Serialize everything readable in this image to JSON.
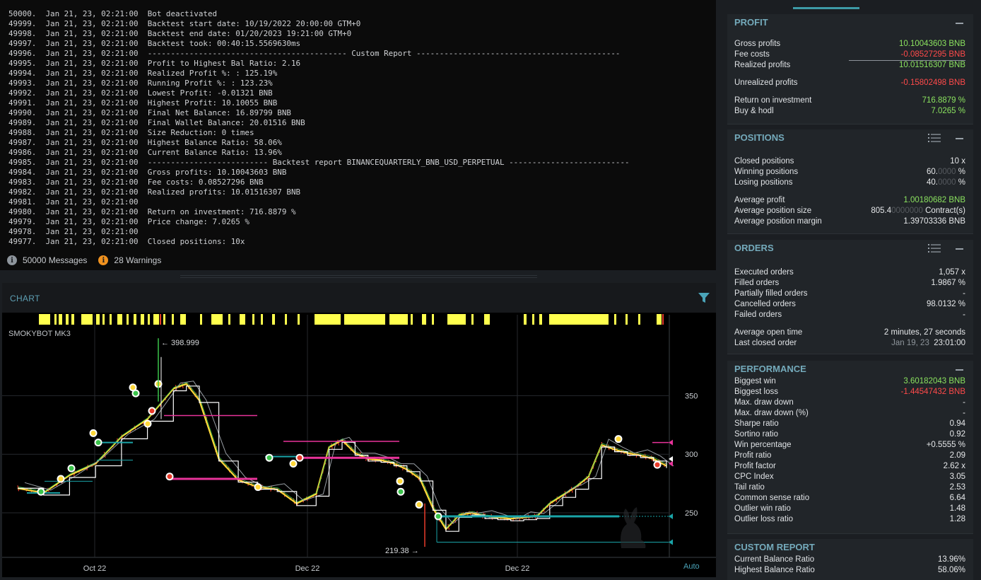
{
  "log": {
    "lines": [
      "50000.  Jan 21, 23, 02:21:00  Bot deactivated",
      "49999.  Jan 21, 23, 02:21:00  Backtest start date: 10/19/2022 20:00:00 GTM+0",
      "49998.  Jan 21, 23, 02:21:00  Backtest end date: 01/20/2023 19:21:00 GTM+0",
      "49997.  Jan 21, 23, 02:21:00  Backtest took: 00:40:15.5569630ms",
      "49996.  Jan 21, 23, 02:21:00  ------------------------------------------- Custom Report --------------------------------------------",
      "49995.  Jan 21, 23, 02:21:00  Profit to Highest Bal Ratio: 2.16",
      "49994.  Jan 21, 23, 02:21:00  Realized Profit %: : 125.19%",
      "49993.  Jan 21, 23, 02:21:00  Running Profit %: : 123.23%",
      "49992.  Jan 21, 23, 02:21:00  Lowest Profit: -0.01321 BNB",
      "49991.  Jan 21, 23, 02:21:00  Highest Profit: 10.10055 BNB",
      "49990.  Jan 21, 23, 02:21:00  Final Net Balance: 16.89799 BNB",
      "49989.  Jan 21, 23, 02:21:00  Final Wallet Balance: 20.01516 BNB",
      "49988.  Jan 21, 23, 02:21:00  Size Reduction: 0 times",
      "49987.  Jan 21, 23, 02:21:00  Highest Balance Ratio: 58.06%",
      "49986.  Jan 21, 23, 02:21:00  Current Balance Ratio: 13.96%",
      "49985.  Jan 21, 23, 02:21:00  -------------------------- Backtest report BINANCEQUARTERLY_BNB_USD_PERPETUAL --------------------------",
      "49984.  Jan 21, 23, 02:21:00  Gross profits: 10.10043603 BNB",
      "49983.  Jan 21, 23, 02:21:00  Fee costs: 0.08527296 BNB",
      "49982.  Jan 21, 23, 02:21:00  Realized profits: 10.01516307 BNB",
      "49981.  Jan 21, 23, 02:21:00",
      "49980.  Jan 21, 23, 02:21:00  Return on investment: 716.8879 %",
      "49979.  Jan 21, 23, 02:21:00  Price change: 7.0265 %",
      "49978.  Jan 21, 23, 02:21:00",
      "49977.  Jan 21, 23, 02:21:00  Closed positions: 10x"
    ],
    "messages_count": "50000 Messages",
    "warnings_count": "28 Warnings"
  },
  "chart": {
    "title": "CHART",
    "strategy_label": "SMOKYBOT MK3",
    "x_labels": [
      "Oct 22",
      "Dec 22",
      "Dec 22"
    ],
    "y_labels": [
      "350",
      "300",
      "250"
    ],
    "high_label": "← 398.999",
    "low_label": "219.38 →",
    "auto_label": "Auto",
    "colors": {
      "accent": "#5e9fb3",
      "highlight": "#ffff4d",
      "magenta": "#e8339a",
      "teal": "#1aa4a8"
    }
  },
  "chart_data": {
    "type": "line",
    "title": "SMOKYBOT MK3",
    "xlabel": "",
    "ylabel": "",
    "x_ticks": [
      "Oct 22",
      "Dec 22",
      "Dec 22"
    ],
    "y_ticks": [
      250,
      300,
      350
    ],
    "ylim": [
      212,
      410
    ],
    "annotations": [
      "398.999",
      "219.38"
    ],
    "series": [
      {
        "x": [
          0,
          4,
          8,
          12,
          16,
          20,
          24,
          26,
          28,
          31,
          34,
          37,
          40,
          43,
          46,
          48,
          50,
          52,
          54,
          56,
          58,
          60,
          62,
          64,
          66,
          68,
          70,
          72,
          74,
          76,
          78,
          80,
          82,
          84,
          86,
          88,
          90,
          92,
          94,
          96,
          98,
          100
        ],
        "values": [
          271,
          267,
          282,
          292,
          315,
          330,
          356,
          360,
          346,
          296,
          278,
          272,
          270,
          258,
          266,
          306,
          312,
          301,
          296,
          295,
          292,
          287,
          279,
          254,
          236,
          248,
          250,
          247,
          246,
          245,
          246,
          247,
          258,
          265,
          272,
          281,
          308,
          304,
          301,
          299,
          296,
          290
        ]
      }
    ]
  },
  "profit": {
    "title": "PROFIT",
    "rows": [
      {
        "label": "Gross profits",
        "value": "10.10043603 BNB"
      },
      {
        "label": "Fee costs",
        "value": "-0.08527295 BNB"
      },
      {
        "label": "Realized profits",
        "value": "10.01516307 BNB"
      },
      {
        "label": "Unrealized profits",
        "value": "-0.15802498 BNB"
      },
      {
        "label": "Return on investment",
        "value": "716.8879 %"
      },
      {
        "label": "Buy & hodl",
        "value": "7.0265 %"
      }
    ]
  },
  "positions": {
    "title": "POSITIONS",
    "closed_positions": {
      "label": "Closed positions",
      "value": "10 x"
    },
    "winning_positions": {
      "label": "Winning positions",
      "value_main": "60.",
      "value_dim": "0000",
      "value_unit": " %"
    },
    "losing_positions": {
      "label": "Losing positions",
      "value_main": "40.",
      "value_dim": "0000",
      "value_unit": " %"
    },
    "average_profit": {
      "label": "Average profit",
      "value": "1.00180682 BNB"
    },
    "average_position_size": {
      "label": "Average position size",
      "value_main": "805.4",
      "value_dim": "0000000",
      "value_unit": " Contract(s)"
    },
    "average_position_margin": {
      "label": "Average position margin",
      "value": "1.39703336 BNB"
    }
  },
  "orders": {
    "title": "ORDERS",
    "rows": [
      {
        "label": "Executed orders",
        "value": "1,057 x"
      },
      {
        "label": "Filled orders",
        "value": "1.9867 %"
      },
      {
        "label": "Partially filled orders",
        "value": "-"
      },
      {
        "label": "Cancelled orders",
        "value": "98.0132 %"
      },
      {
        "label": "Failed orders",
        "value": "-"
      }
    ],
    "average_open_time": {
      "label": "Average open time",
      "value": "2 minutes, 27 seconds"
    },
    "last_closed_order": {
      "label": "Last closed order",
      "date": "Jan 19, 23",
      "time": "23:01:00"
    }
  },
  "performance": {
    "title": "PERFORMANCE",
    "rows": [
      {
        "label": "Biggest win",
        "value": "3.60182043 BNB"
      },
      {
        "label": "Biggest loss",
        "value": "-1.44547432 BNB"
      },
      {
        "label": "Max. draw down",
        "value": "-"
      },
      {
        "label": "Max. draw down (%)",
        "value": "-"
      },
      {
        "label": "Sharpe ratio",
        "value": "0.94"
      },
      {
        "label": "Sortino ratio",
        "value": "0.92"
      },
      {
        "label": "Win percentage",
        "value": "+0.5555 %"
      },
      {
        "label": "Profit ratio",
        "value": "2.09"
      },
      {
        "label": "Profit factor",
        "value": "2.62 x"
      },
      {
        "label": "CPC Index",
        "value": "3.05"
      },
      {
        "label": "Tail ratio",
        "value": "2.53"
      },
      {
        "label": "Common sense ratio",
        "value": "6.64"
      },
      {
        "label": "Outlier win ratio",
        "value": "1.48"
      },
      {
        "label": "Outlier loss ratio",
        "value": "1.28"
      }
    ]
  },
  "custom_report": {
    "title": "CUSTOM REPORT",
    "rows": [
      {
        "label": "Current Balance Ratio",
        "value": "13.96%"
      },
      {
        "label": "Highest Balance Ratio",
        "value": "58.06%"
      }
    ]
  }
}
